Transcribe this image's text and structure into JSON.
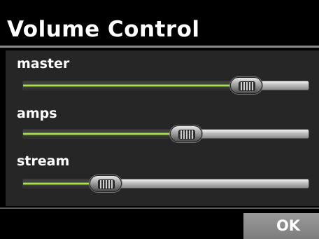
{
  "window": {
    "title": "Volume Control"
  },
  "sliders": [
    {
      "label": "master",
      "level": 0.78
    },
    {
      "label": "amps",
      "level": 0.57
    },
    {
      "label": "stream",
      "level": 0.29
    }
  ],
  "actions": {
    "ok_label": "OK"
  },
  "colors": {
    "fill": "#a8e04a",
    "background": "#000000",
    "panel": "#262626"
  }
}
